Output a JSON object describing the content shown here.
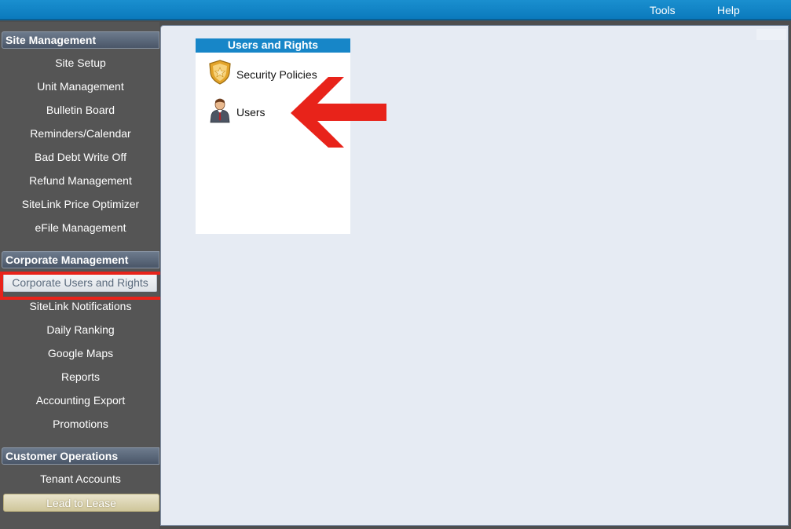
{
  "topbar": {
    "menus": [
      "Tools",
      "Help"
    ]
  },
  "sidebar": {
    "sections": [
      {
        "header": "Site Management",
        "items": [
          "Site Setup",
          "Unit Management",
          "Bulletin Board",
          "Reminders/Calendar",
          "Bad Debt Write Off",
          "Refund Management",
          "SiteLink Price Optimizer",
          "eFile Management"
        ]
      },
      {
        "header": "Corporate Management",
        "items": [
          "Corporate Users and Rights",
          "SiteLink Notifications",
          "Daily Ranking",
          "Google Maps",
          "Reports",
          "Accounting Export",
          "Promotions"
        ]
      },
      {
        "header": "Customer Operations",
        "items": [
          "Tenant Accounts",
          "Lead to Lease"
        ]
      }
    ],
    "selected_item": "Corporate Users and Rights",
    "highlighted_item": "Lead to Lease"
  },
  "panel": {
    "title": "Users and Rights",
    "items": [
      {
        "label": "Security Policies",
        "icon": "shield-icon"
      },
      {
        "label": "Users",
        "icon": "user-icon"
      }
    ]
  },
  "annotation": {
    "arrow_color": "#e8231a",
    "box_color": "#e8231a"
  },
  "colors": {
    "topbar": "#0b7abd",
    "panel_title": "#1786c8",
    "sidebar_bg": "#555555",
    "main_bg": "#e6ebf3"
  }
}
